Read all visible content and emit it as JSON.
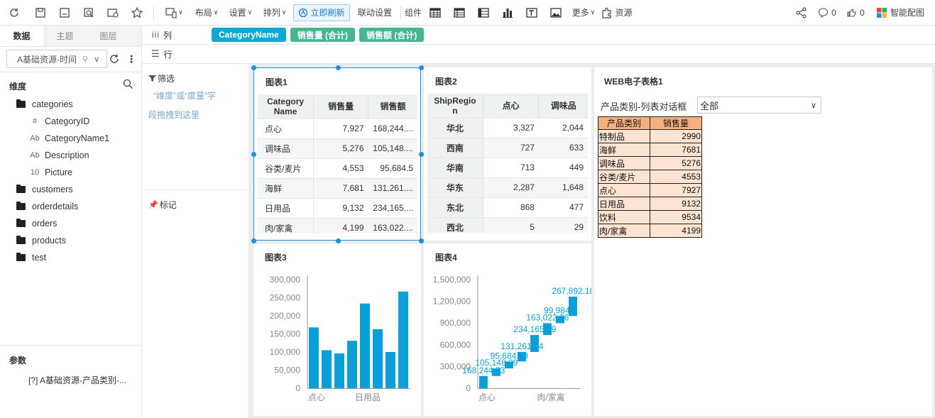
{
  "toolbar": {
    "layout": "布局",
    "settings": "设置",
    "arrange": "排列",
    "refresh": "立即刷新",
    "linkage": "联动设置",
    "components": "组件",
    "more": "更多",
    "resources": "资源",
    "comments": "0",
    "likes": "0",
    "smart": "智能配图"
  },
  "left": {
    "tabs": [
      "数据",
      "主题",
      "图层"
    ],
    "dataset": "A基础资源-时间",
    "dim_title": "维度",
    "tree": [
      {
        "t": "folder",
        "label": "categories"
      },
      {
        "t": "num",
        "icon": "#",
        "label": "CategoryID"
      },
      {
        "t": "str",
        "icon": "Ab",
        "label": "CategoryName1"
      },
      {
        "t": "str",
        "icon": "Ab",
        "label": "Description"
      },
      {
        "t": "bin",
        "icon": "10",
        "label": "Picture"
      },
      {
        "t": "folder",
        "label": "customers"
      },
      {
        "t": "folder",
        "label": "orderdetails"
      },
      {
        "t": "folder",
        "label": "orders"
      },
      {
        "t": "folder",
        "label": "products"
      },
      {
        "t": "folder",
        "label": "test"
      }
    ],
    "params_title": "参数",
    "param": "[?] A基础资源-产品类别-..."
  },
  "shelf": {
    "col_label": "列",
    "row_label": "行",
    "filter_label": "筛选",
    "filter_hint1": "“维度”或“度量”字",
    "filter_hint2": "段拖拽到这里",
    "mark_label": "标记",
    "pills": [
      {
        "label": "CategoryName",
        "color": "#0fa8d3"
      },
      {
        "label": "销售量 (合计)",
        "color": "#45b691"
      },
      {
        "label": "销售额 (合计)",
        "color": "#45b691"
      }
    ]
  },
  "chart1": {
    "title": "图表1",
    "headers": [
      "Category Name",
      "销售量",
      "销售额"
    ],
    "rows": [
      [
        "点心",
        "7,927",
        "168,244...."
      ],
      [
        "调味品",
        "5,276",
        "105,148...."
      ],
      [
        "谷类/麦片",
        "4,553",
        "95,684.5"
      ],
      [
        "海鲜",
        "7,681",
        "131,261...."
      ],
      [
        "日用品",
        "9,132",
        "234,165...."
      ],
      [
        "肉/家禽",
        "4,199",
        "163,022...."
      ]
    ]
  },
  "chart2": {
    "title": "图表2",
    "headers": [
      "ShipRegion",
      "点心",
      "调味品"
    ],
    "rows": [
      [
        "华北",
        "3,327",
        "2,044"
      ],
      [
        "西南",
        "727",
        "633"
      ],
      [
        "华南",
        "713",
        "449"
      ],
      [
        "华东",
        "2,287",
        "1,648"
      ],
      [
        "东北",
        "868",
        "477"
      ],
      [
        "西北",
        "5",
        "29"
      ]
    ]
  },
  "chart3": {
    "title": "图表3",
    "xticks": [
      "点心",
      "日用品"
    ]
  },
  "chart4": {
    "title": "图表4",
    "xticks": [
      "点心",
      "肉/家禽"
    ]
  },
  "web": {
    "title": "WEB电子表格1",
    "filter_label": "产品类别-列表对话框",
    "filter_value": "全部",
    "headers": [
      "产品类别",
      "销售量"
    ],
    "rows": [
      [
        "特制品",
        "2990"
      ],
      [
        "海鲜",
        "7681"
      ],
      [
        "调味品",
        "5276"
      ],
      [
        "谷类/麦片",
        "4553"
      ],
      [
        "点心",
        "7927"
      ],
      [
        "日用品",
        "9132"
      ],
      [
        "饮料",
        "9534"
      ],
      [
        "肉/家禽",
        "4199"
      ]
    ]
  },
  "chart_data": [
    {
      "type": "bar",
      "title": "图表3",
      "categories": [
        "点心",
        "",
        "",
        "",
        "日用品",
        "",
        "",
        ""
      ],
      "values": [
        168000,
        105000,
        96000,
        131000,
        234000,
        163000,
        100000,
        267000
      ],
      "ylim": [
        0,
        300000
      ],
      "yticks": [
        "300,000",
        "250,000",
        "200,000",
        "150,000",
        "100,000",
        "50,000",
        "0"
      ],
      "color": "#0a9fd8"
    },
    {
      "type": "bar",
      "title": "图表4",
      "categories": [
        "点心",
        "",
        "",
        "",
        "",
        "肉/家禽",
        "",
        ""
      ],
      "values": [
        168244.73,
        105148.29,
        95684.59,
        131261.74,
        234165.29,
        163022.36,
        99984.8,
        267892.18
      ],
      "labels": [
        "168,244.73",
        "105,148.29",
        "95,684.59",
        "131,261.74",
        "234,165.29",
        "163,022.36",
        "99,984.8",
        "267,892.18"
      ],
      "ylim": [
        0,
        1500000
      ],
      "yticks": [
        "1,500,000",
        "1,200,000",
        "900,000",
        "600,000",
        "300,000",
        "0"
      ],
      "color": "#0a9fd8"
    }
  ]
}
